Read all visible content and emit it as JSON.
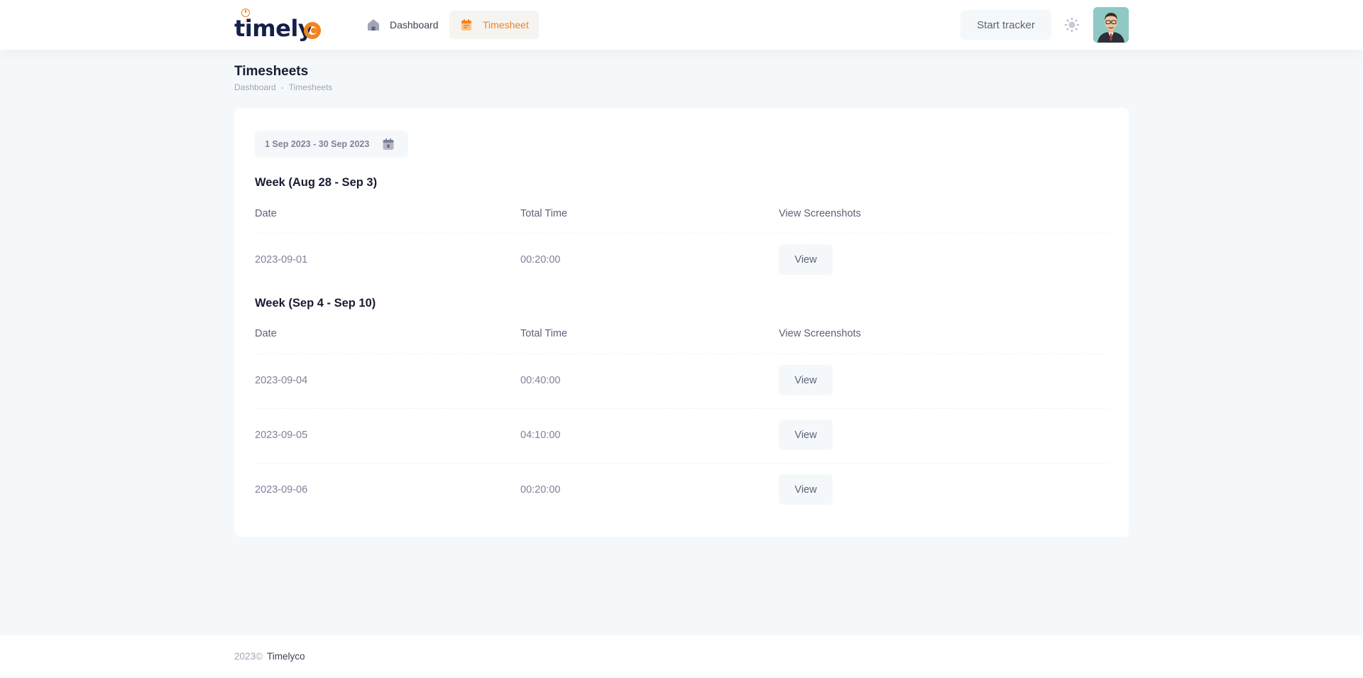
{
  "header": {
    "logo_text": "timelyco",
    "nav": [
      {
        "label": "Dashboard",
        "icon": "home-icon",
        "active": false
      },
      {
        "label": "Timesheet",
        "icon": "calendar-icon",
        "active": true
      }
    ],
    "start_tracker_label": "Start tracker",
    "theme_icon": "sun-icon",
    "accent_color": "#f0841f"
  },
  "page": {
    "title": "Timesheets",
    "breadcrumb": [
      "Dashboard",
      "-",
      "Timesheets"
    ]
  },
  "card": {
    "date_range": "1 Sep 2023 - 30 Sep 2023",
    "columns": [
      "Date",
      "Total Time",
      "View Screenshots"
    ],
    "weeks": [
      {
        "title": "Week (Aug 28 - Sep 3)",
        "rows": [
          {
            "date": "2023-09-01",
            "total": "00:20:00",
            "action": "View"
          }
        ]
      },
      {
        "title": "Week (Sep 4 - Sep 10)",
        "rows": [
          {
            "date": "2023-09-04",
            "total": "00:40:00",
            "action": "View"
          },
          {
            "date": "2023-09-05",
            "total": "04:10:00",
            "action": "View"
          },
          {
            "date": "2023-09-06",
            "total": "00:20:00",
            "action": "View"
          }
        ]
      }
    ]
  },
  "footer": {
    "year": "2023©",
    "brand": "Timelyco"
  }
}
